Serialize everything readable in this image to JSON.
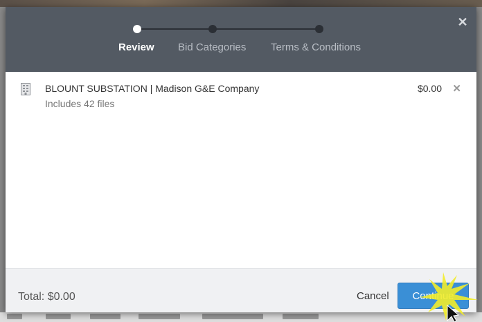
{
  "wizard": {
    "steps": [
      {
        "label": "Review",
        "active": true
      },
      {
        "label": "Bid Categories",
        "active": false
      },
      {
        "label": "Terms & Conditions",
        "active": false
      }
    ],
    "close_icon": "close-icon"
  },
  "cart": {
    "items": [
      {
        "icon": "building-icon",
        "title": "BLOUNT SUBSTATION | Madison G&E Company",
        "subtitle": "Includes 42 files",
        "price": "$0.00",
        "remove_icon": "remove-icon"
      }
    ]
  },
  "footer": {
    "total_label": "Total: $0.00",
    "cancel_label": "Cancel",
    "continue_label": "Continue"
  },
  "colors": {
    "header_bg": "#535a63",
    "primary_button": "#3a8fd6",
    "footer_bg": "#f0f1f3"
  }
}
